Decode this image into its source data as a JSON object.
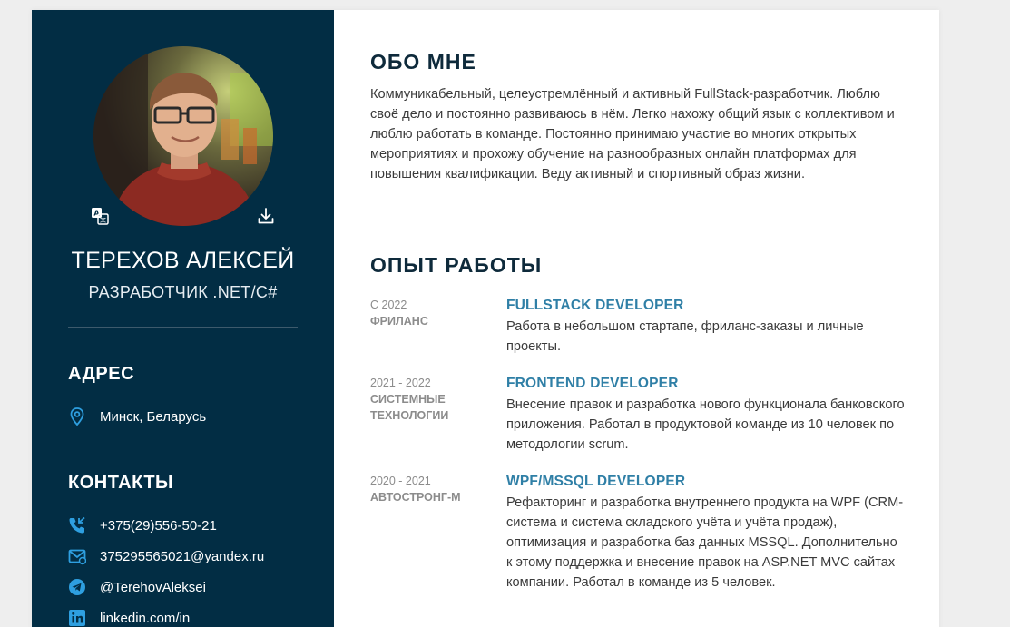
{
  "profile": {
    "name": "ТЕРЕХОВ АЛЕКСЕЙ",
    "role": "РАЗРАБОТЧИК .NET/C#"
  },
  "sidebar": {
    "address_heading": "АДРЕС",
    "address": "Минск, Беларусь",
    "contacts_heading": "КОНТАКТЫ",
    "contacts": [
      {
        "icon": "phone-icon",
        "text": "+375(29)556-50-21"
      },
      {
        "icon": "email-icon",
        "text": "375295565021@yandex.ru"
      },
      {
        "icon": "telegram-icon",
        "text": "@TerehovAleksei"
      },
      {
        "icon": "linkedin-icon",
        "text": "linkedin.com/in"
      }
    ]
  },
  "about": {
    "heading": "ОБО МНЕ",
    "text": "Коммуникабельный, целеустремлённый и активный FullStack-разработчик. Люблю своё дело и постоянно развиваюсь в нём. Легко нахожу общий язык с коллективом и люблю работать в команде. Постоянно принимаю участие во многих открытых мероприятиях и прохожу обучение на разнообразных онлайн платформах для повышения квалификации. Веду активный и спортивный образ жизни."
  },
  "experience": {
    "heading": "ОПЫТ РАБОТЫ",
    "jobs": [
      {
        "date": "С 2022",
        "company": "ФРИЛАНС",
        "title": "FULLSTACK DEVELOPER",
        "description": "Работа в небольшом стартапе, фриланс-заказы и личные проекты."
      },
      {
        "date": "2021 - 2022",
        "company": "СИСТЕМНЫЕ ТЕХНОЛОГИИ",
        "title": "FRONTEND DEVELOPER",
        "description": "Внесение правок и разработка нового функционала банковского приложения. Работал в продуктовой команде из 10 человек по методологии scrum."
      },
      {
        "date": "2020 - 2021",
        "company": "АВТОСТРОНГ-М",
        "title": "WPF/MSSQL DEVELOPER",
        "description": "Рефакторинг и разработка внутреннего продукта на WPF (CRM-система и система складского учёта и учёта продаж), оптимизация и разработка баз данных MSSQL. Дополнительно к этому поддержка и внесение правок на ASP.NET MVC сайтах компании. Работал в команде из 5 человек."
      }
    ]
  },
  "colors": {
    "sidebar_bg": "#022d44",
    "accent": "#2f7fa6",
    "icon_blue": "#2e9fe0",
    "heading_dark": "#0e2a3b"
  },
  "icons": {
    "translate": "translate-icon",
    "download": "download-icon",
    "location": "location-pin-icon"
  }
}
